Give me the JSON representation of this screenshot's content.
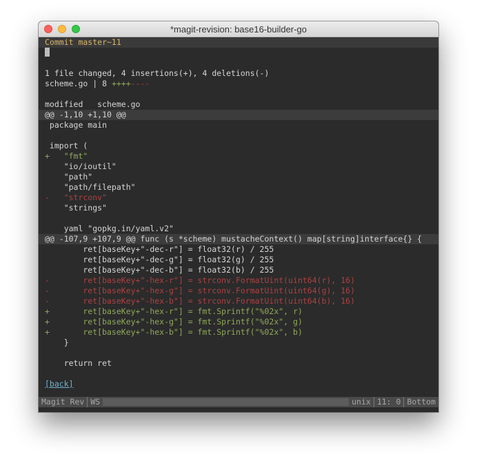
{
  "window": {
    "title": "*magit-revision: base16-builder-go"
  },
  "header": {
    "text": "Commit master~11"
  },
  "summary": {
    "changed": "1 file changed, 4 insertions(+), 4 deletions(-)",
    "stat_file": "scheme.go | 8 ",
    "stat_plus": "++++",
    "stat_minus": "----"
  },
  "file_header": "modified   scheme.go",
  "hunk1": {
    "header": "@@ -1,10 +1,10 @@",
    "lines": [
      " package main",
      "",
      " import (",
      "+   \"fmt\"",
      "    \"io/ioutil\"",
      "    \"path\"",
      "    \"path/filepath\"",
      "-   \"strconv\"",
      "    \"strings\"",
      "",
      "    yaml \"gopkg.in/yaml.v2\""
    ]
  },
  "hunk2": {
    "header": "@@ -107,9 +107,9 @@ func (s *scheme) mustacheContext() map[string]interface{} {",
    "lines": [
      "        ret[baseKey+\"-dec-r\"] = float32(r) / 255",
      "        ret[baseKey+\"-dec-g\"] = float32(g) / 255",
      "        ret[baseKey+\"-dec-b\"] = float32(b) / 255",
      "-       ret[baseKey+\"-hex-r\"] = strconv.FormatUint(uint64(r), 16)",
      "-       ret[baseKey+\"-hex-g\"] = strconv.FormatUint(uint64(g), 16)",
      "-       ret[baseKey+\"-hex-b\"] = strconv.FormatUint(uint64(b), 16)",
      "+       ret[baseKey+\"-hex-r\"] = fmt.Sprintf(\"%02x\", r)",
      "+       ret[baseKey+\"-hex-g\"] = fmt.Sprintf(\"%02x\", g)",
      "+       ret[baseKey+\"-hex-b\"] = fmt.Sprintf(\"%02x\", b)",
      "    }",
      "",
      "    return ret"
    ]
  },
  "back_link": "[back]",
  "modeline": {
    "mode": "Magit Rev",
    "ws": "WS",
    "eol": "unix",
    "position": "11: 0",
    "scroll": "Bottom"
  },
  "colors": {
    "background": "#2b2b2b",
    "added": "#90a959",
    "removed": "#ac4142",
    "header": "#d8b56a",
    "link": "#6fb3d2"
  }
}
